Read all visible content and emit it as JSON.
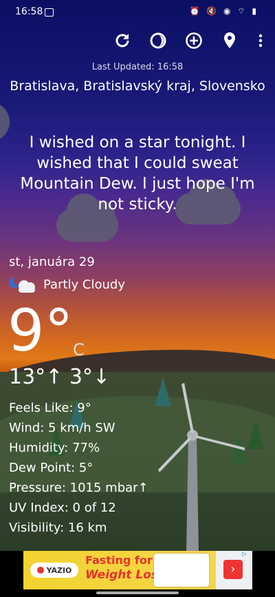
{
  "status_bar": {
    "time": "16:58",
    "system_icons": [
      "image-icon",
      "alarm-icon",
      "mute-icon",
      "hotspot-icon",
      "wifi-icon",
      "signal-icon",
      "battery-icon"
    ]
  },
  "toolbar": {
    "icons": [
      "refresh-icon",
      "moon-phase-icon",
      "add-location-icon",
      "location-pin-icon",
      "more-vert-icon"
    ]
  },
  "header": {
    "last_updated": "Last Updated: 16:58",
    "location": "Bratislava, Bratislavský kraj, Slovensko"
  },
  "quote": "I wished on a star tonight. I wished that I could sweat Mountain Dew. I just hope I'm not sticky.",
  "current": {
    "date": "st, januára 29",
    "condition": "Partly Cloudy",
    "temperature": "9°",
    "unit": "C",
    "high_low": "13°↑ 3°↓"
  },
  "details": {
    "feels_like": "Feels Like:  9°",
    "wind": "Wind:  5 km/h SW",
    "humidity": "Humidity:  77%",
    "dew_point": "Dew Point:  5°",
    "pressure": "Pressure:  1015 mbar↑",
    "uv_index": "UV Index:  0 of 12",
    "visibility": "Visibility:  16 km"
  },
  "ad": {
    "brand": "YAZIO",
    "title": "Fasting for",
    "subtitle": "Weight Loss",
    "arrow": "›",
    "info": "▷"
  },
  "colors": {
    "sky_top": "#0a0f63",
    "sky_sunset": "#e07a18",
    "ad_yellow": "#f2d330",
    "ad_red": "#e6322f"
  }
}
